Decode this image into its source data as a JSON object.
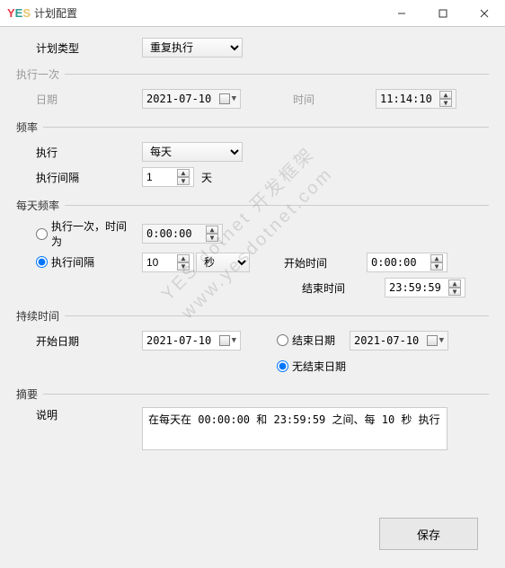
{
  "window": {
    "title": "计划配置",
    "logo_y": "Y",
    "logo_e": "E",
    "logo_s": "S"
  },
  "plan_type": {
    "label": "计划类型",
    "value": "重复执行"
  },
  "once": {
    "legend": "执行一次",
    "date_label": "日期",
    "date_value": "2021-07-10",
    "time_label": "时间",
    "time_value": "11:14:10"
  },
  "freq": {
    "legend": "频率",
    "exec_label": "执行",
    "exec_value": "每天",
    "interval_label": "执行间隔",
    "interval_value": "1",
    "interval_unit": "天"
  },
  "daily": {
    "legend": "每天频率",
    "opt_once_label": "执行一次，时间为",
    "opt_once_time": "0:00:00",
    "opt_interval_label": "执行间隔",
    "interval_value": "10",
    "interval_unit": "秒",
    "start_label": "开始时间",
    "start_time": "0:00:00",
    "end_label": "结束时间",
    "end_time": "23:59:59",
    "selected": "interval"
  },
  "duration": {
    "legend": "持续时间",
    "start_label": "开始日期",
    "start_date": "2021-07-10",
    "end_date_label": "结束日期",
    "end_date_value": "2021-07-10",
    "no_end_label": "无结束日期",
    "selected": "no_end"
  },
  "summary": {
    "legend": "摘要",
    "desc_label": "说明",
    "desc_text": "在每天在 00:00:00 和 23:59:59 之间、每 10 秒 执行"
  },
  "buttons": {
    "save": "保存"
  },
  "watermark": {
    "line1": "YES dotnet 开发框架",
    "line2": "www.yesdotnet.com"
  }
}
